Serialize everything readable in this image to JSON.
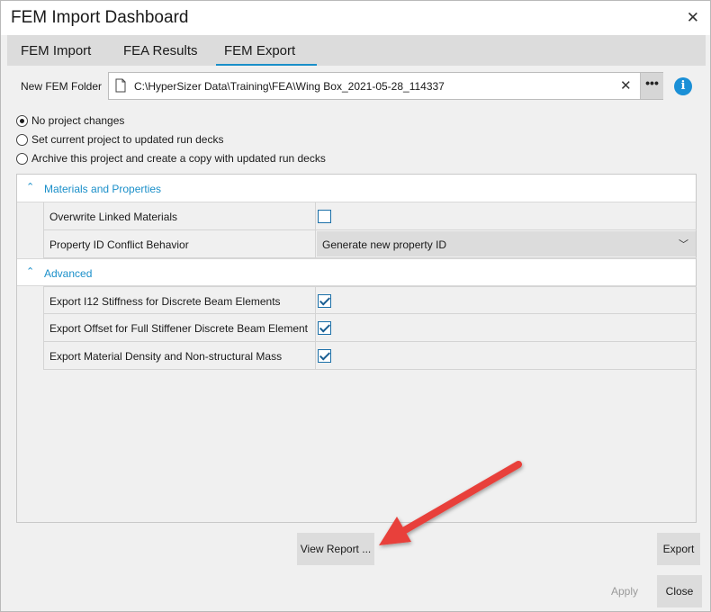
{
  "window": {
    "title": "FEM Import Dashboard",
    "close_icon": "close-icon"
  },
  "tabs": [
    {
      "label": "FEM Import",
      "active": false
    },
    {
      "label": "FEA Results",
      "active": false
    },
    {
      "label": "FEM Export",
      "active": true
    }
  ],
  "folder": {
    "label": "New FEM Folder",
    "value": "C:\\HyperSizer Data\\Training\\FEA\\Wing Box_2021-05-28_114337",
    "clear_glyph": "✕",
    "browse_label": "•••",
    "info_glyph": "i"
  },
  "project_options": [
    {
      "label": "No project changes",
      "selected": true
    },
    {
      "label": "Set current project to updated run decks",
      "selected": false
    },
    {
      "label": "Archive this project and create a copy with updated run decks",
      "selected": false
    }
  ],
  "sections": {
    "materials": {
      "title": "Materials and Properties",
      "overwrite_label": "Overwrite Linked Materials",
      "overwrite_checked": false,
      "conflict_label": "Property ID Conflict Behavior",
      "conflict_value": "Generate new property ID"
    },
    "advanced": {
      "title": "Advanced",
      "rows": [
        {
          "label": "Export I12 Stiffness for Discrete Beam Elements",
          "checked": true
        },
        {
          "label": "Export Offset for Full Stiffener Discrete Beam Element",
          "checked": true
        },
        {
          "label": "Export Material Density and Non-structural Mass",
          "checked": true
        }
      ]
    }
  },
  "buttons": {
    "view_report": "View Report ...",
    "export": "Export",
    "apply": "Apply",
    "close": "Close"
  },
  "colors": {
    "accent": "#1a8fc9",
    "annotation_arrow": "#e8403a"
  }
}
